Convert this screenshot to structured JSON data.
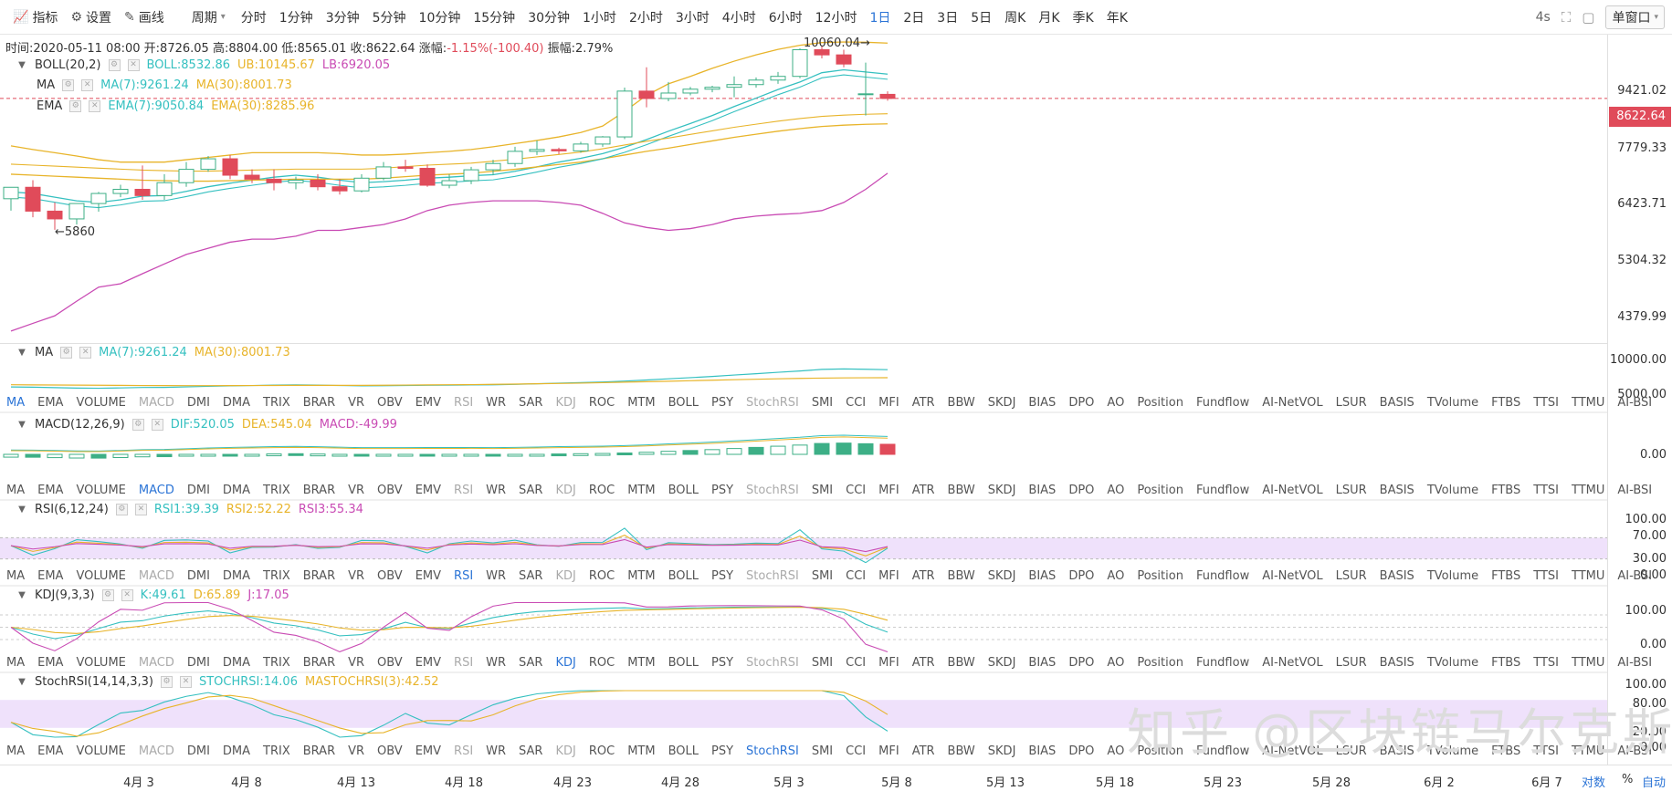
{
  "toolbar": {
    "indicator_label": "指标",
    "settings_label": "设置",
    "draw_label": "画线",
    "period_label": "周期",
    "periods": [
      "分时",
      "1分钟",
      "3分钟",
      "5分钟",
      "10分钟",
      "15分钟",
      "30分钟",
      "1小时",
      "2小时",
      "3小时",
      "4小时",
      "6小时",
      "12小时",
      "1日",
      "2日",
      "3日",
      "5日",
      "周K",
      "月K",
      "季K",
      "年K"
    ],
    "active_period": "1日",
    "refresh": "4s",
    "window_label": "单窗口"
  },
  "info": {
    "time": "时间:2020-05-11 08:00",
    "open": "开:8726.05",
    "high": "高:8804.00",
    "low": "低:8565.01",
    "close": "收:8622.64",
    "change_label": "涨幅:",
    "change": "-1.15%(-100.40)",
    "amplitude": "振幅:2.79%"
  },
  "main_indicators": {
    "boll": {
      "name": "BOLL(20,2)",
      "boll": "BOLL:8532.86",
      "ub": "UB:10145.67",
      "lb": "LB:6920.05"
    },
    "ma": {
      "name": "MA",
      "ma7": "MA(7):9261.24",
      "ma30": "MA(30):8001.73"
    },
    "ema": {
      "name": "EMA",
      "ema7": "EMA(7):9050.84",
      "ema30": "EMA(30):8285.96"
    }
  },
  "annotations": {
    "high": "10060.04",
    "low": "5860"
  },
  "price_axis": [
    "9421.02",
    "7779.33",
    "6423.71",
    "5304.32",
    "4379.99"
  ],
  "current_price": "8622.64",
  "sub_panels": {
    "ma": {
      "name": "MA",
      "ma7": "MA(7):9261.24",
      "ma30": "MA(30):8001.73",
      "y": [
        "10000.00",
        "5000.00"
      ]
    },
    "macd": {
      "name": "MACD(12,26,9)",
      "dif": "DIF:520.05",
      "dea": "DEA:545.04",
      "macd": "MACD:-49.99",
      "y": [
        "0.00"
      ]
    },
    "rsi": {
      "name": "RSI(6,12,24)",
      "rsi1": "RSI1:39.39",
      "rsi2": "RSI2:52.22",
      "rsi3": "RSI3:55.34",
      "y": [
        "100.00",
        "70.00",
        "30.00",
        "0.00"
      ]
    },
    "kdj": {
      "name": "KDJ(9,3,3)",
      "k": "K:49.61",
      "d": "D:65.89",
      "j": "J:17.05",
      "y": [
        "100.00",
        "0.00"
      ]
    },
    "stochrsi": {
      "name": "StochRSI(14,14,3,3)",
      "stoch": "STOCHRSI:14.06",
      "ma": "MASTOCHRSI(3):42.52",
      "y": [
        "100.00",
        "80.00",
        "20.00",
        "0.00"
      ]
    }
  },
  "indicator_tabs": [
    "MA",
    "EMA",
    "VOLUME",
    "MACD",
    "DMI",
    "DMA",
    "TRIX",
    "BRAR",
    "VR",
    "OBV",
    "EMV",
    "RSI",
    "WR",
    "SAR",
    "KDJ",
    "ROC",
    "MTM",
    "BOLL",
    "PSY",
    "StochRSI",
    "SMI",
    "CCI",
    "MFI",
    "ATR",
    "BBW",
    "SKDJ",
    "BIAS",
    "DPO",
    "AO",
    "Position",
    "Fundflow",
    "AI-NetVOL",
    "LSUR",
    "BASIS",
    "TVolume",
    "FTBS",
    "TTSI",
    "TTMU",
    "AI-BSI"
  ],
  "x_axis": [
    "4月 3",
    "4月 8",
    "4月 13",
    "4月 18",
    "4月 23",
    "4月 28",
    "5月 3",
    "5月 8",
    "5月 13",
    "5月 18",
    "5月 23",
    "5月 28",
    "6月 2",
    "6月 7"
  ],
  "scale_options": {
    "log": "对数",
    "pct": "%",
    "auto": "自动"
  },
  "watermark": "知乎 @区块链马尔克斯",
  "colors": {
    "up": "#3daf86",
    "down": "#e04b5a",
    "ma7": "#35c0c0",
    "ma30": "#e8b42a",
    "lb": "#c94bb4",
    "accent": "#2b74d6"
  },
  "chart_data": {
    "type": "candlestick",
    "x": [
      "4月1",
      "4月2",
      "4月3",
      "4月4",
      "4月5",
      "4月6",
      "4月7",
      "4月8",
      "4月9",
      "4月10",
      "4月11",
      "4月12",
      "4月13",
      "4月14",
      "4月15",
      "4月16",
      "4月17",
      "4月18",
      "4月19",
      "4月20",
      "4月21",
      "4月22",
      "4月23",
      "4月24",
      "4月25",
      "4月26",
      "4月27",
      "4月28",
      "4月29",
      "4月30",
      "5月1",
      "5月2",
      "5月3",
      "5月4",
      "5月5",
      "5月6",
      "5月7",
      "5月8",
      "5月9",
      "5月10",
      "5月11"
    ],
    "open": [
      6420,
      6640,
      6190,
      6050,
      6330,
      6520,
      6600,
      6480,
      6730,
      7000,
      7220,
      6880,
      6800,
      6730,
      6780,
      6650,
      6570,
      6820,
      7050,
      7020,
      6680,
      6770,
      6990,
      7120,
      7380,
      7420,
      7390,
      7540,
      7700,
      8810,
      8620,
      8760,
      8860,
      8910,
      8980,
      9100,
      9200,
      9950,
      9800,
      8740,
      8726
    ],
    "close": [
      6640,
      6190,
      6050,
      6330,
      6520,
      6600,
      6480,
      6730,
      7000,
      7220,
      6880,
      6800,
      6730,
      6780,
      6650,
      6570,
      6820,
      7050,
      7020,
      6680,
      6770,
      6990,
      7120,
      7380,
      7420,
      7390,
      7540,
      7700,
      8810,
      8620,
      8760,
      8860,
      8910,
      8980,
      9100,
      9200,
      9950,
      9800,
      9540,
      8740,
      8622
    ],
    "high": [
      6520,
      6780,
      6350,
      6320,
      6550,
      6690,
      7080,
      6900,
      7150,
      7280,
      7300,
      7000,
      7000,
      6850,
      6900,
      6800,
      6900,
      7150,
      7200,
      7100,
      6900,
      7050,
      7200,
      7480,
      7620,
      7460,
      7590,
      7720,
      8900,
      9450,
      9050,
      8920,
      8950,
      9200,
      9170,
      9320,
      9990,
      10060,
      9950,
      9580,
      8804
    ],
    "low": [
      6200,
      6080,
      5860,
      5950,
      6180,
      6450,
      6400,
      6400,
      6650,
      6950,
      6800,
      6720,
      6580,
      6600,
      6580,
      6500,
      6540,
      6780,
      6950,
      6650,
      6620,
      6700,
      6880,
      7050,
      7300,
      7320,
      7350,
      7480,
      7650,
      8400,
      8550,
      8700,
      8780,
      8650,
      8900,
      9000,
      9150,
      9700,
      9450,
      8200,
      8565
    ],
    "ylim": [
      4200,
      10400
    ],
    "series": [
      {
        "name": "MA(7)",
        "values": [
          6550,
          6520,
          6450,
          6380,
          6350,
          6400,
          6470,
          6480,
          6560,
          6650,
          6720,
          6780,
          6840,
          6880,
          6840,
          6780,
          6730,
          6750,
          6780,
          6820,
          6840,
          6870,
          6890,
          6960,
          7050,
          7150,
          7230,
          7330,
          7470,
          7640,
          7830,
          8010,
          8200,
          8420,
          8630,
          8850,
          9050,
          9300,
          9380,
          9320,
          9261
        ]
      },
      {
        "name": "MA(30)",
        "values": [
          6900,
          6880,
          6860,
          6840,
          6820,
          6800,
          6780,
          6770,
          6760,
          6760,
          6770,
          6780,
          6790,
          6800,
          6800,
          6800,
          6800,
          6820,
          6850,
          6880,
          6900,
          6920,
          6960,
          7000,
          7050,
          7100,
          7150,
          7220,
          7300,
          7380,
          7450,
          7530,
          7610,
          7690,
          7760,
          7830,
          7890,
          7940,
          7970,
          7990,
          8001
        ]
      },
      {
        "name": "UB",
        "values": [
          7500,
          7420,
          7350,
          7280,
          7200,
          7150,
          7150,
          7150,
          7200,
          7250,
          7300,
          7350,
          7350,
          7350,
          7350,
          7330,
          7300,
          7300,
          7320,
          7350,
          7380,
          7420,
          7480,
          7550,
          7620,
          7700,
          7800,
          7950,
          8300,
          8700,
          9000,
          9200,
          9420,
          9620,
          9800,
          9960,
          10080,
          10160,
          10180,
          10170,
          10145
        ]
      },
      {
        "name": "LB",
        "values": [
          4350,
          4450,
          4550,
          4750,
          4950,
          5000,
          5150,
          5300,
          5450,
          5550,
          5650,
          5700,
          5700,
          5750,
          5850,
          5850,
          5900,
          5950,
          6050,
          6200,
          6300,
          6350,
          6380,
          6380,
          6380,
          6350,
          6300,
          6150,
          5980,
          5900,
          5850,
          5880,
          5950,
          6050,
          6100,
          6130,
          6150,
          6200,
          6350,
          6600,
          6920
        ]
      }
    ]
  }
}
